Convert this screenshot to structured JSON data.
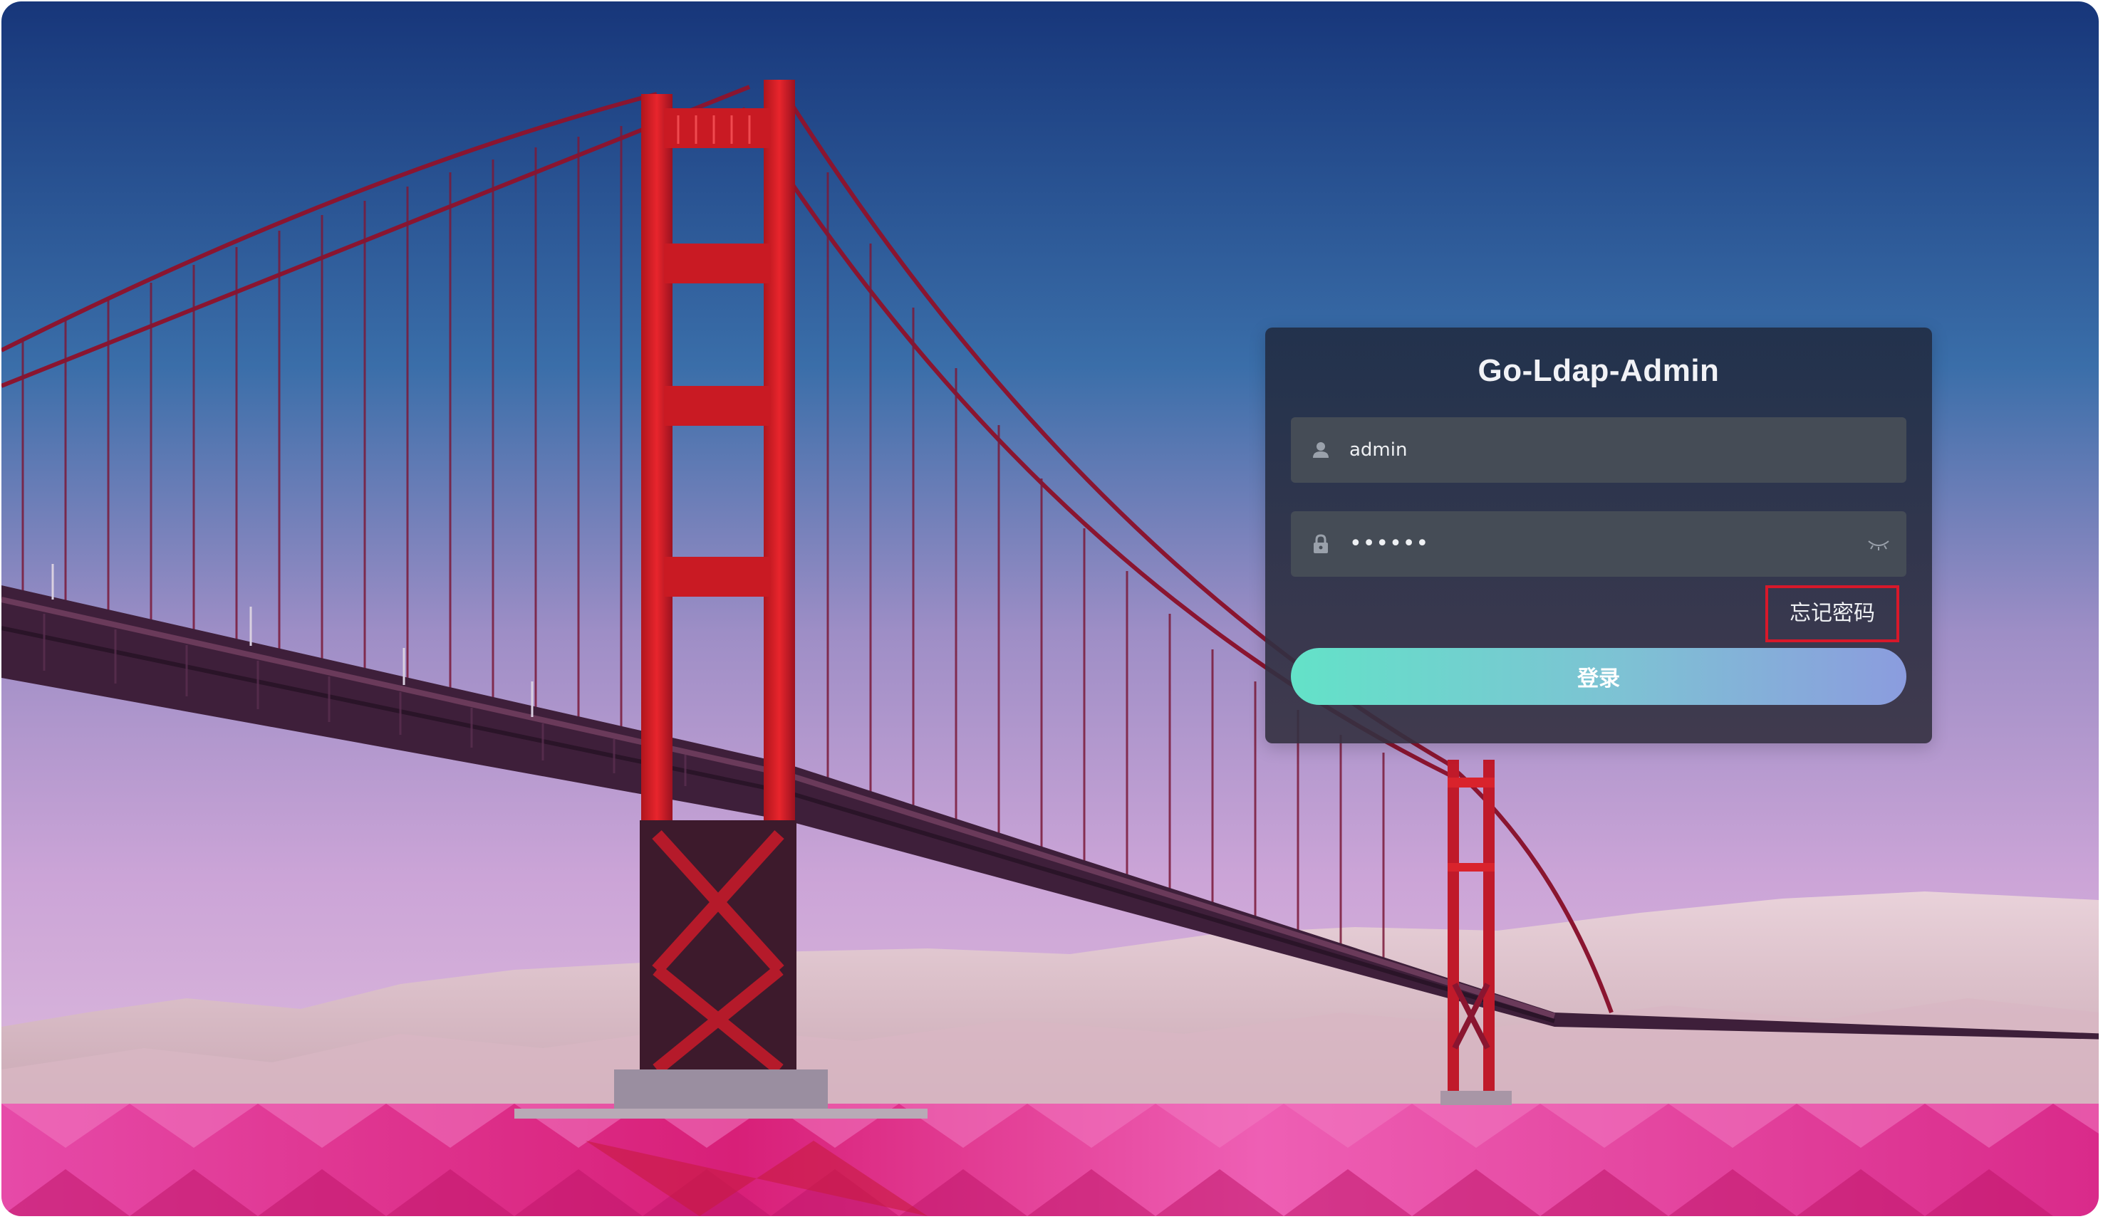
{
  "app": {
    "title": "Go-Ldap-Admin"
  },
  "login_form": {
    "username": {
      "value": "admin",
      "icon": "user-icon"
    },
    "password": {
      "masked_value": "••••••",
      "icon": "lock-icon",
      "toggle_icon": "eye-closed-icon"
    },
    "forgot_password_label": "忘记密码",
    "submit_label": "登录"
  },
  "colors": {
    "button_gradient_start": "#63e2c8",
    "button_gradient_end": "#8b9cde",
    "highlight_border": "#d8182a",
    "card_background": "#2a3446",
    "field_background": "#454c56"
  }
}
